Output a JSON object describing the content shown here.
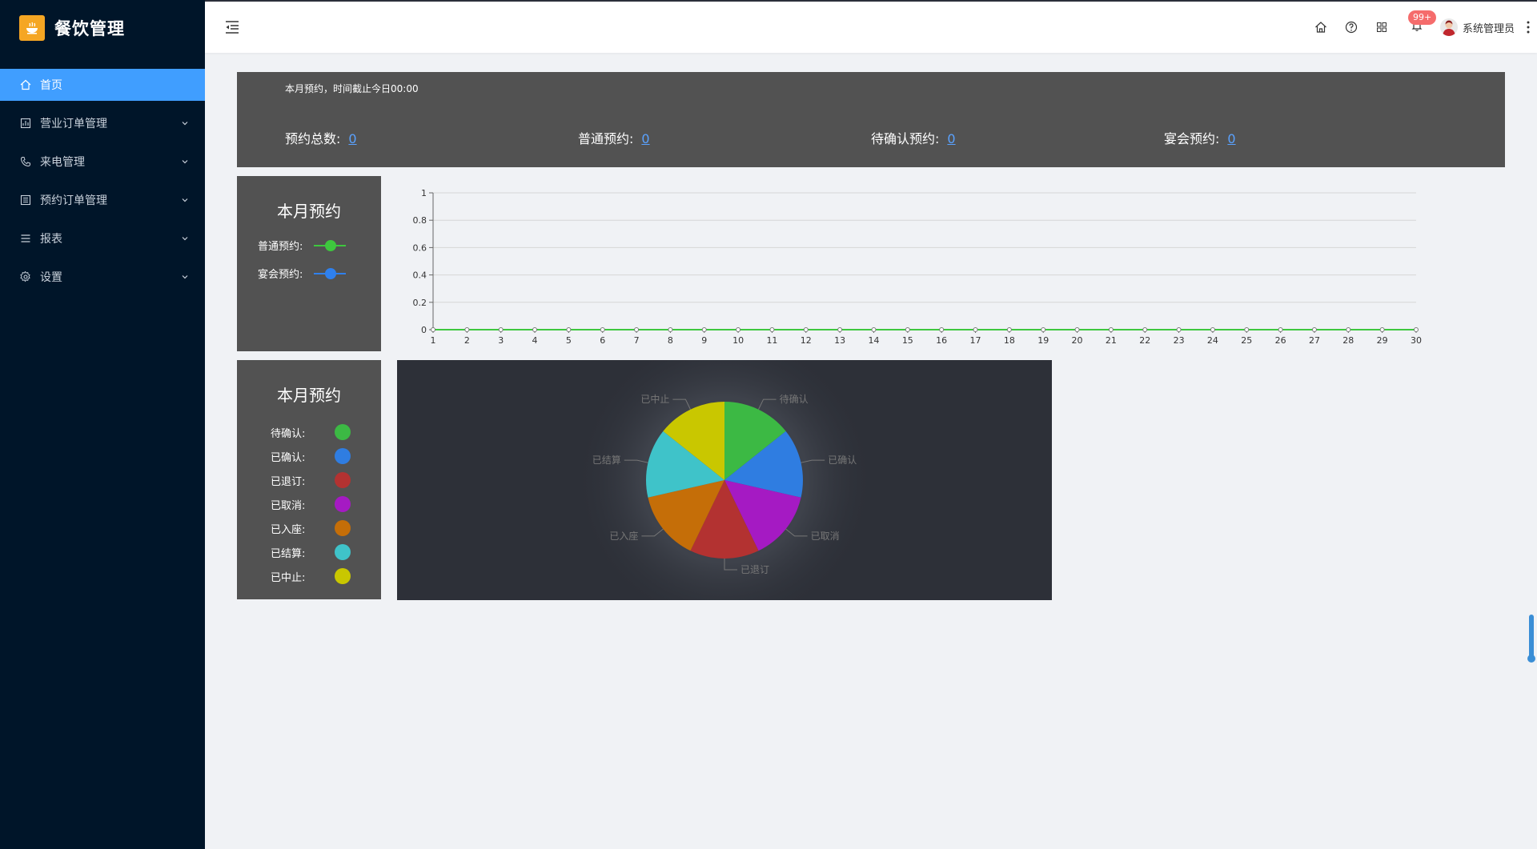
{
  "app": {
    "title": "餐饮管理"
  },
  "sidebar": {
    "items": [
      {
        "label": "首页",
        "icon": "home-icon",
        "active": true
      },
      {
        "label": "营业订单管理",
        "icon": "chart-icon"
      },
      {
        "label": "来电管理",
        "icon": "phone-icon"
      },
      {
        "label": "预约订单管理",
        "icon": "list-icon"
      },
      {
        "label": "报表",
        "icon": "menu-icon"
      },
      {
        "label": "设置",
        "icon": "gear-icon"
      }
    ]
  },
  "header": {
    "badge": "99+",
    "user": "系统管理员"
  },
  "stats": {
    "note": "本月预约，时间截止今日00:00",
    "items": [
      {
        "label": "预约总数:",
        "value": "0"
      },
      {
        "label": "普通预约:",
        "value": "0"
      },
      {
        "label": "待确认预约:",
        "value": "0"
      },
      {
        "label": "宴会预约:",
        "value": "0"
      }
    ]
  },
  "line_legend": {
    "title": "本月预约",
    "items": [
      {
        "label": "普通预约:",
        "color": "#3ec73e"
      },
      {
        "label": "宴会预约:",
        "color": "#2f80ed"
      }
    ]
  },
  "pie_legend": {
    "title": "本月预约",
    "items": [
      {
        "label": "待确认:",
        "color": "#3cb944"
      },
      {
        "label": "已确认:",
        "color": "#2f7de1"
      },
      {
        "label": "已退订:",
        "color": "#b33231"
      },
      {
        "label": "已取消:",
        "color": "#a51ac3"
      },
      {
        "label": "已入座:",
        "color": "#c56e08"
      },
      {
        "label": "已结算:",
        "color": "#3fc3c9"
      },
      {
        "label": "已中止:",
        "color": "#c9c700"
      }
    ]
  },
  "chart_data": [
    {
      "type": "line",
      "x": [
        1,
        2,
        3,
        4,
        5,
        6,
        7,
        8,
        9,
        10,
        11,
        12,
        13,
        14,
        15,
        16,
        17,
        18,
        19,
        20,
        21,
        22,
        23,
        24,
        25,
        26,
        27,
        28,
        29,
        30
      ],
      "ylim": [
        0,
        1
      ],
      "yticks": [
        0,
        0.2,
        0.4,
        0.6,
        0.8,
        1
      ],
      "grid": true,
      "series": [
        {
          "name": "普通预约",
          "color": "#3ec73e",
          "values": [
            0,
            0,
            0,
            0,
            0,
            0,
            0,
            0,
            0,
            0,
            0,
            0,
            0,
            0,
            0,
            0,
            0,
            0,
            0,
            0,
            0,
            0,
            0,
            0,
            0,
            0,
            0,
            0,
            0,
            0
          ]
        },
        {
          "name": "宴会预约",
          "color": "#2f80ed",
          "values": [
            0,
            0,
            0,
            0,
            0,
            0,
            0,
            0,
            0,
            0,
            0,
            0,
            0,
            0,
            0,
            0,
            0,
            0,
            0,
            0,
            0,
            0,
            0,
            0,
            0,
            0,
            0,
            0,
            0,
            0
          ]
        }
      ]
    },
    {
      "type": "pie",
      "categories": [
        "待确认",
        "已确认",
        "已取消",
        "已退订",
        "已入座",
        "已结算",
        "已中止"
      ],
      "values": [
        1,
        1,
        1,
        1,
        1,
        1,
        1
      ],
      "colors": [
        "#3cb944",
        "#2f7de1",
        "#a51ac3",
        "#b33231",
        "#c56e08",
        "#3fc3c9",
        "#c9c700"
      ]
    }
  ]
}
